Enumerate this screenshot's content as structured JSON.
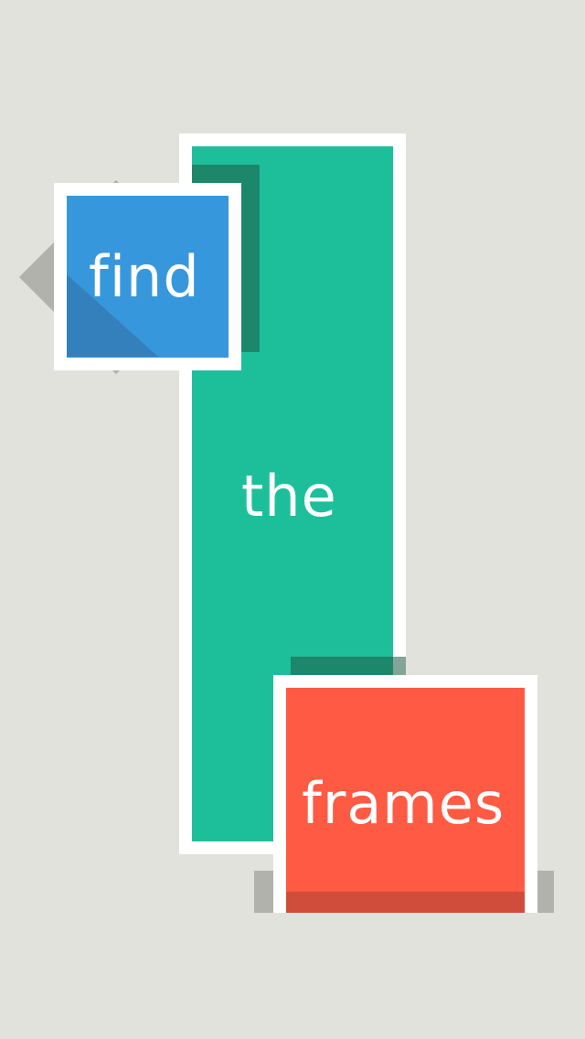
{
  "background_color": "#e2e2dd",
  "frames": {
    "find": {
      "label": "find",
      "color": "#3797dc"
    },
    "the": {
      "label": "the",
      "color": "#1dbf9b"
    },
    "frames": {
      "label": "frames",
      "color": "#ff5a43"
    }
  },
  "frame_border_color": "#ffffff"
}
